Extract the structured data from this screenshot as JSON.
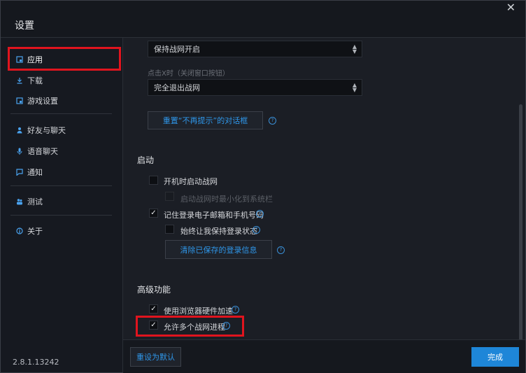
{
  "window": {
    "title": "设置"
  },
  "sidebar": {
    "items": [
      {
        "label": "应用",
        "icon": "app-icon",
        "active": true
      },
      {
        "label": "下载",
        "icon": "download-icon"
      },
      {
        "label": "游戏设置",
        "icon": "game-settings-icon"
      },
      {
        "label": "好友与聊天",
        "icon": "friends-icon"
      },
      {
        "label": "语音聊天",
        "icon": "microphone-icon"
      },
      {
        "label": "通知",
        "icon": "notification-icon"
      },
      {
        "label": "测试",
        "icon": "test-icon"
      },
      {
        "label": "关于",
        "icon": "info-icon"
      }
    ],
    "version": "2.8.1.13242"
  },
  "main": {
    "select1": {
      "value": "保持战网开启"
    },
    "close_label": "点击X时（关闭窗口按钮）",
    "select2": {
      "value": "完全退出战网"
    },
    "reset_dialogs_label": "重置“不再提示”的对话框",
    "startup": {
      "heading": "启动",
      "launch_on_boot": {
        "label": "开机时启动战网",
        "checked": false
      },
      "minimize_to_tray": {
        "label": "启动战网时最小化到系统栏",
        "checked": false,
        "disabled": true
      },
      "remember_login": {
        "label": "记住登录电子邮箱和手机号码",
        "checked": true
      },
      "keep_logged_in": {
        "label": "始终让我保持登录状态",
        "checked": false
      },
      "clear_login_label": "清除已保存的登录信息"
    },
    "advanced": {
      "heading": "高级功能",
      "hw_accel": {
        "label": "使用浏览器硬件加速",
        "checked": true
      },
      "multi_process": {
        "label": "允许多个战网进程",
        "checked": true
      }
    }
  },
  "footer": {
    "reset_default_label": "重设为默认",
    "done_label": "完成"
  },
  "colors": {
    "accent": "#1e86d8",
    "highlight": "#e0141e",
    "link": "#2f97ea"
  }
}
